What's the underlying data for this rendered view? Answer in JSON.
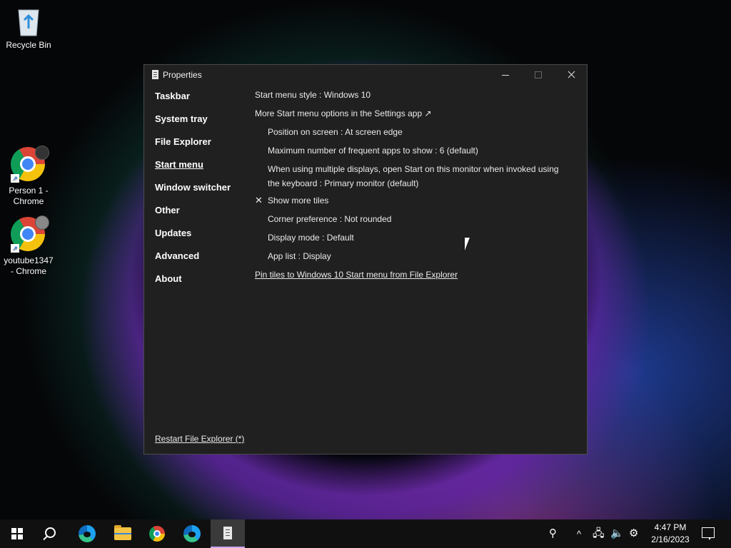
{
  "desktop": {
    "icons": [
      {
        "label": "Recycle Bin"
      },
      {
        "label_line1": "Person 1 -",
        "label_line2": "Chrome"
      },
      {
        "label_line1": "youtube1347",
        "label_line2": "- Chrome"
      }
    ]
  },
  "window": {
    "title": "Properties",
    "nav": [
      {
        "label": "Taskbar"
      },
      {
        "label": "System tray"
      },
      {
        "label": "File Explorer"
      },
      {
        "label": "Start menu",
        "active": true
      },
      {
        "label": "Window switcher"
      },
      {
        "label": "Other"
      },
      {
        "label": "Updates"
      },
      {
        "label": "Advanced"
      },
      {
        "label": "About"
      }
    ],
    "settings": {
      "start_menu_style": "Start menu style : Windows 10",
      "more_options": "More Start menu options in the Settings app ↗",
      "position": "Position on screen : At screen edge",
      "max_frequent": "Maximum number of frequent apps to show : 6 (default)",
      "multi_display": "When using multiple displays, open Start on this monitor when invoked using the keyboard : Primary monitor (default)",
      "show_more_tiles": "Show more tiles",
      "show_more_tiles_checked_mark": "✕",
      "corner_pref": "Corner preference : Not rounded",
      "display_mode": "Display mode : Default",
      "app_list": "App list : Display",
      "pin_tiles_link": "Pin tiles to Windows 10 Start menu from File Explorer"
    },
    "restart_link": "Restart File Explorer (*)"
  },
  "taskbar": {
    "tray": {
      "chevron": "^",
      "time": "4:47 PM",
      "date": "2/16/2023"
    },
    "accent_color": "#c7a7f0"
  }
}
